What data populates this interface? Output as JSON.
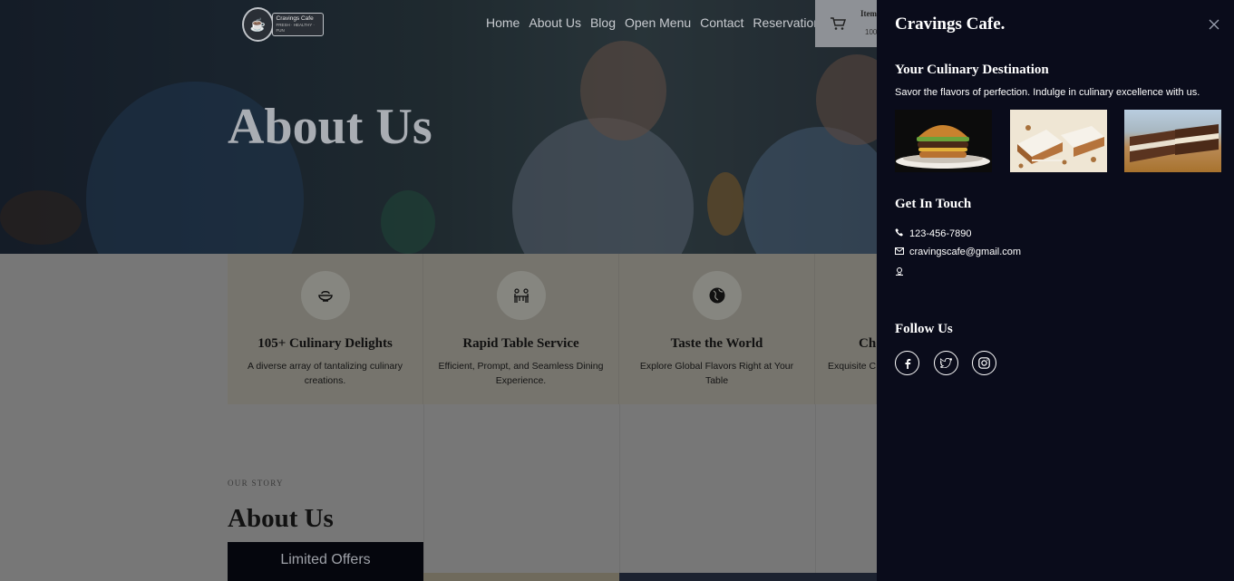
{
  "logo": {
    "name": "Cravings Cafe",
    "tagline": "FRESH · HEALTHY · FUN"
  },
  "nav": [
    "Home",
    "About Us",
    "Blog",
    "Open Menu",
    "Contact",
    "Reservation"
  ],
  "cart": {
    "label": "Item",
    "count": "100"
  },
  "hero": {
    "title": "About Us"
  },
  "features": [
    {
      "icon": "food-bowl-icon",
      "title": "105+ Culinary Delights",
      "text": "A diverse array of tantalizing culinary creations."
    },
    {
      "icon": "dining-table-icon",
      "title": "Rapid Table Service",
      "text": "Efficient, Prompt, and Seamless Dining Experience."
    },
    {
      "icon": "globe-icon",
      "title": "Taste the World",
      "text": "Explore Global Flavors Right at Your Table"
    },
    {
      "icon": "chef-icon",
      "title": "Ch",
      "text": "Exquisite C"
    }
  ],
  "story": {
    "tag": "OUR STORY",
    "title": "About Us",
    "offers_label": "Limited Offers"
  },
  "panel": {
    "title": "Cravings Cafe.",
    "destination_heading": "Your Culinary Destination",
    "destination_text": "Savor the flavors of perfection. Indulge in culinary excellence with us.",
    "images": [
      "burger-image",
      "carrot-cake-image",
      "chocolate-bar-image"
    ],
    "contact_heading": "Get In Touch",
    "phone": "123-456-7890",
    "email": "cravingscafe@gmail.com",
    "follow_heading": "Follow Us",
    "socials": [
      "facebook-icon",
      "twitter-icon",
      "instagram-icon"
    ]
  }
}
